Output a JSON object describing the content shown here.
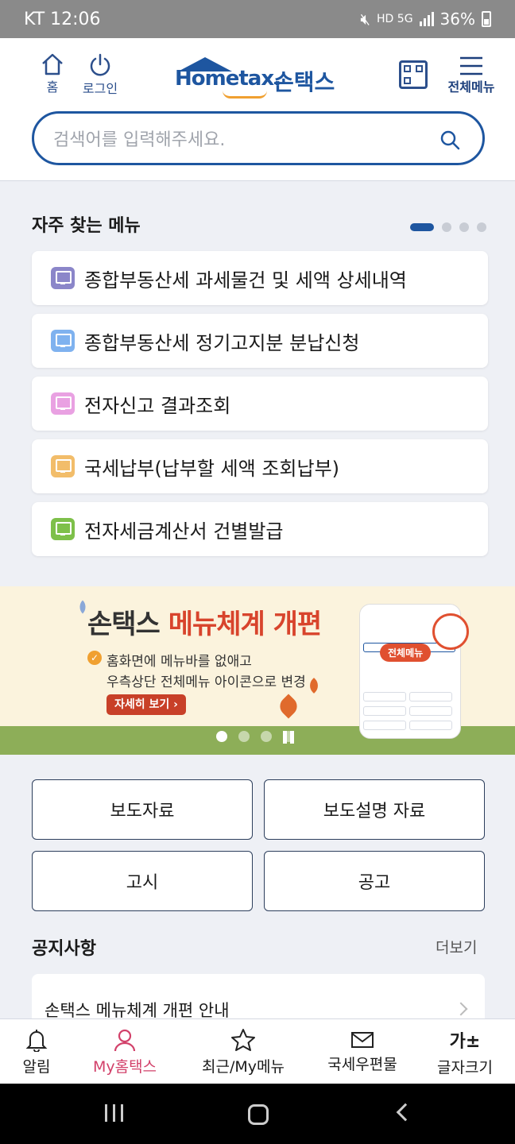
{
  "status": {
    "carrier_time": "KT 12:06",
    "indicators": "HD 5G",
    "battery": "36%"
  },
  "header": {
    "home_label": "홈",
    "login_label": "로그인",
    "logo_en": "Hometax.",
    "logo_ko": "손택스",
    "menu_label": "전체메뉴",
    "search_placeholder": "검색어를 입력해주세요."
  },
  "frequent": {
    "title": "자주 찾는 메뉴",
    "items": [
      {
        "label": "종합부동산세 과세물건 및 세액 상세내역",
        "color": "#8b86c9"
      },
      {
        "label": "종합부동산세 정기고지분 분납신청",
        "color": "#7fb2ef"
      },
      {
        "label": "전자신고 결과조회",
        "color": "#e9a1e2"
      },
      {
        "label": "국세납부(납부할 세액 조회납부)",
        "color": "#f2bd6a"
      },
      {
        "label": "전자세금계산서 건별발급",
        "color": "#7ec04a"
      }
    ]
  },
  "banner": {
    "title_plain": "손택스 ",
    "title_highlight": "메뉴체계 개편",
    "line1": "홈화면에 메뉴바를 없애고",
    "line2": "우측상단 전체메뉴 아이콘으로 변경",
    "more_button": "자세히 보기 ›",
    "phone_tag": "전체메뉴"
  },
  "buttons": {
    "press": "보도자료",
    "press_explain": "보도설명 자료",
    "notice_gosi": "고시",
    "notice_gonggo": "공고"
  },
  "notice": {
    "title": "공지사항",
    "more": "더보기",
    "first_item": "손택스 메뉴체계 개편 안내"
  },
  "bottom_nav": {
    "alarm": "알림",
    "my_hometax": "My홈택스",
    "recent": "최근/My메뉴",
    "mail": "국세우편물",
    "font_size": "글자크기",
    "font_size_icon": "가±"
  }
}
